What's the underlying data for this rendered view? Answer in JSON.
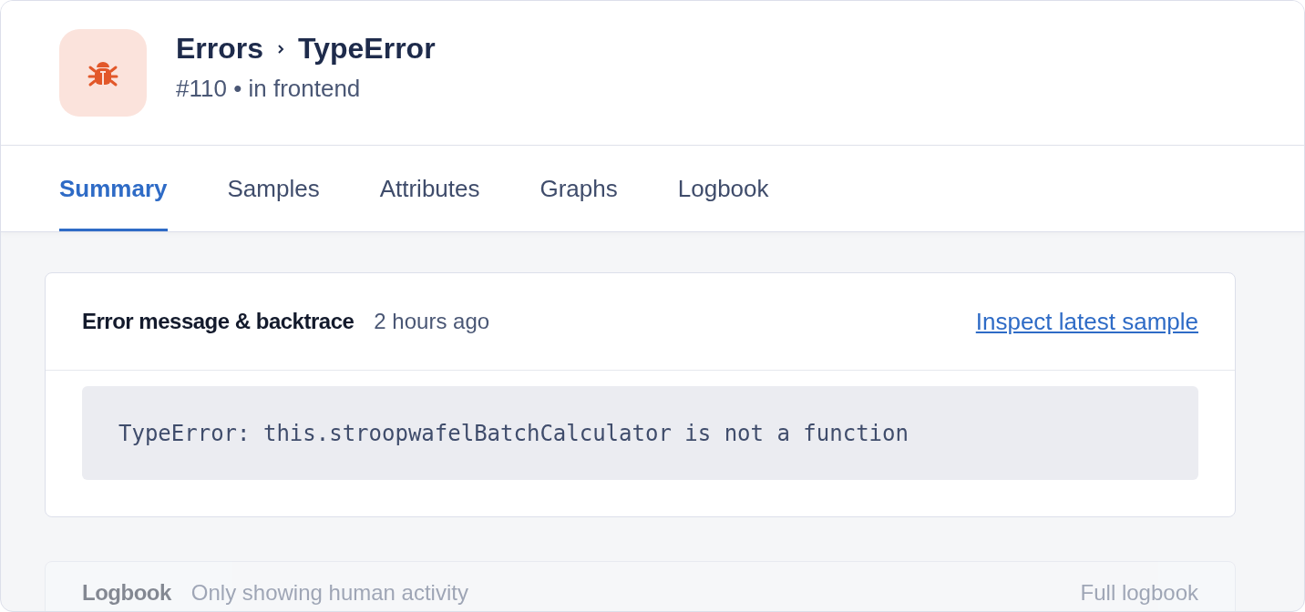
{
  "header": {
    "breadcrumb": [
      "Errors",
      "TypeError"
    ],
    "subtitle": "#110 • in frontend"
  },
  "tabs": [
    {
      "label": "Summary",
      "selected": true
    },
    {
      "label": "Samples",
      "selected": false
    },
    {
      "label": "Attributes",
      "selected": false
    },
    {
      "label": "Graphs",
      "selected": false
    },
    {
      "label": "Logbook",
      "selected": false
    }
  ],
  "error_card": {
    "title": "Error message & backtrace",
    "time": "2 hours ago",
    "link": "Inspect latest sample",
    "message": "TypeError: this.stroopwafelBatchCalculator is not a function"
  },
  "logbook_card": {
    "title": "Logbook",
    "note": "Only showing human activity",
    "link": "Full logbook"
  }
}
